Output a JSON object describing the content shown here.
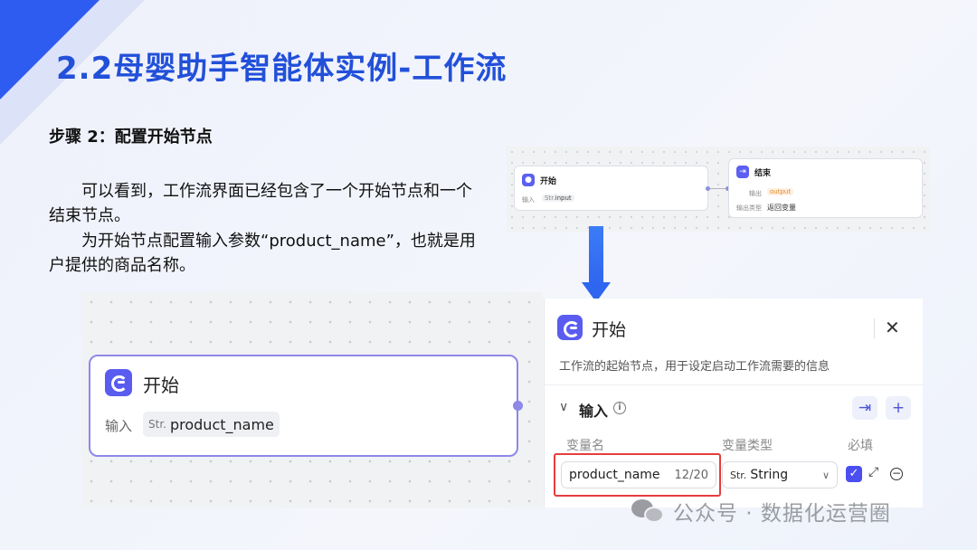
{
  "slide": {
    "title": "2.2母婴助手智能体实例-工作流",
    "step_heading": "步骤 2：配置开始节点",
    "paragraph1": "可以看到，工作流界面已经包含了一个开始节点和一个结束节点。",
    "paragraph2": "为开始节点配置输入参数“product_name”，也就是用户提供的商品名称。"
  },
  "mini_canvas": {
    "start_node": {
      "title": "开始",
      "input_label": "输入",
      "type_prefix": "Str.",
      "input_name": "input"
    },
    "end_node": {
      "title": "结束",
      "output_label": "输出",
      "output_value": "output",
      "output_type_label": "输出类型",
      "output_type_value": "返回变量"
    }
  },
  "canvas": {
    "start_node": {
      "title": "开始",
      "input_label": "输入",
      "type_prefix": "Str.",
      "param_name": "product_name"
    }
  },
  "panel": {
    "title": "开始",
    "description": "工作流的起始节点，用于设定启动工作流需要的信息",
    "section_title": "输入",
    "columns": {
      "name": "变量名",
      "type": "变量类型",
      "required": "必填"
    },
    "row": {
      "name": "product_name",
      "count": "12/20",
      "type_prefix": "Str.",
      "type": "String",
      "required": true
    },
    "icons": {
      "close": "close-icon",
      "info": "info-icon",
      "import": "import-icon",
      "add": "plus-icon",
      "expand": "expand-icon",
      "remove": "minus-circle-icon"
    }
  },
  "watermark": {
    "text": "公众号 · 数据化运营圈"
  },
  "colors": {
    "title": "#2250d9",
    "accent": "#5a5cf0",
    "arrow": "#2f66ef",
    "highlight": "#e53d3d"
  }
}
